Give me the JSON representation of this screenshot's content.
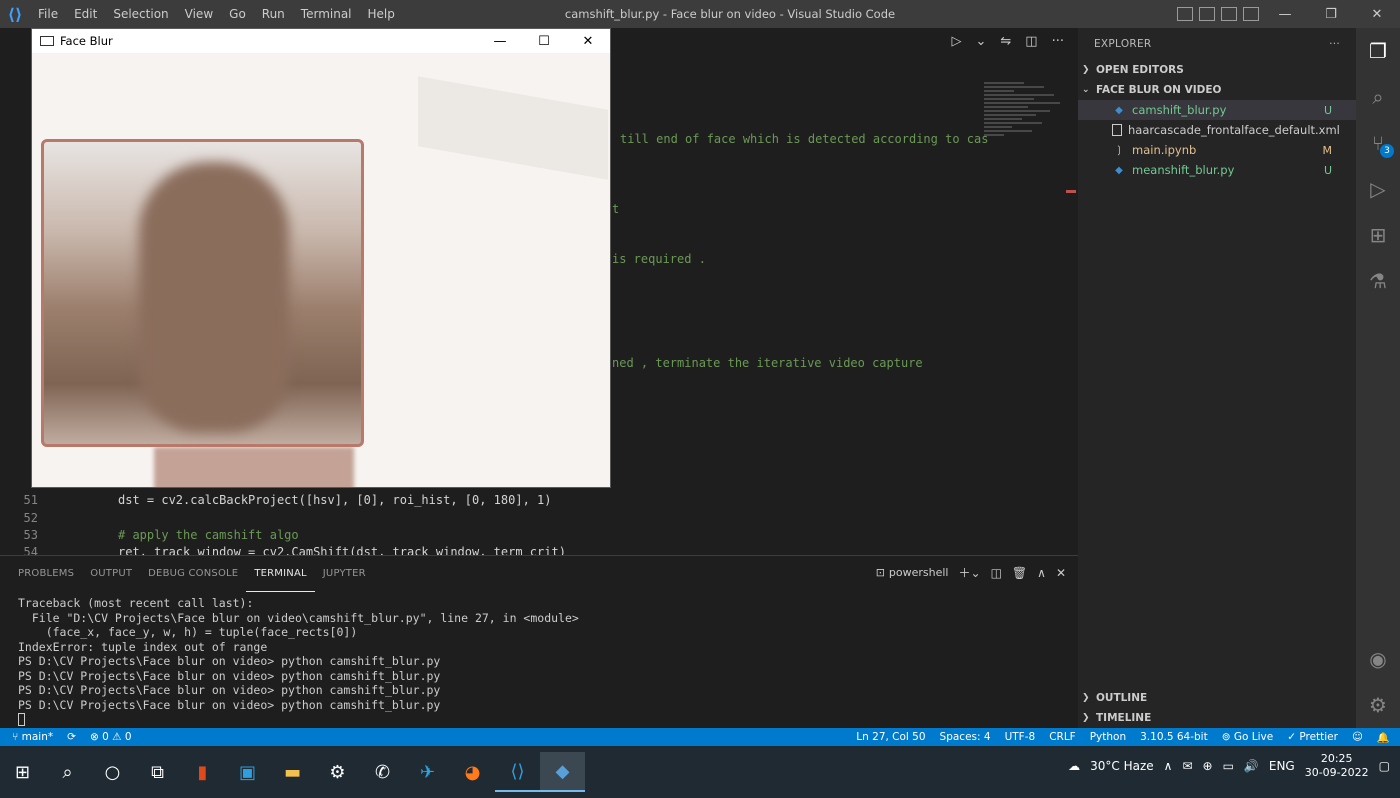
{
  "titlebar": {
    "menu": [
      "File",
      "Edit",
      "Selection",
      "View",
      "Go",
      "Run",
      "Terminal",
      "Help"
    ],
    "window_title": "camshift_blur.py - Face blur on video - Visual Studio Code"
  },
  "face_window": {
    "title": "Face Blur"
  },
  "editor": {
    "code_fragments": [
      "till end of face which is detected according to cas",
      "t",
      "is required .",
      "ned , terminate the iterative video capture"
    ],
    "lines": [
      {
        "num": "51",
        "code": "dst = cv2.calcBackProject([hsv], [0], roi_hist, [0, 180], 1)"
      },
      {
        "num": "52",
        "code": ""
      },
      {
        "num": "53",
        "code": "# apply the camshift algo"
      },
      {
        "num": "54",
        "code": "ret, track_window = cv2.CamShift(dst, track_window, term_crit)"
      }
    ]
  },
  "explorer": {
    "title": "EXPLORER",
    "open_editors": "OPEN EDITORS",
    "folder": "FACE BLUR ON VIDEO",
    "files": [
      {
        "name": "camshift_blur.py",
        "status": "U",
        "icon": "python-icon"
      },
      {
        "name": "haarcascade_frontalface_default.xml",
        "status": "",
        "icon": "xml-icon"
      },
      {
        "name": "main.ipynb",
        "status": "M",
        "icon": "notebook-icon"
      },
      {
        "name": "meanshift_blur.py",
        "status": "U",
        "icon": "python-icon"
      }
    ],
    "outline": "OUTLINE",
    "timeline": "TIMELINE"
  },
  "activity_bar": {
    "source_control_badge": "3"
  },
  "panel": {
    "tabs": [
      "PROBLEMS",
      "OUTPUT",
      "DEBUG CONSOLE",
      "TERMINAL",
      "JUPYTER"
    ],
    "active_tab": "TERMINAL",
    "shell": "powershell",
    "terminal_lines": [
      "Traceback (most recent call last):",
      "  File \"D:\\CV Projects\\Face blur on video\\camshift_blur.py\", line 27, in <module>",
      "    (face_x, face_y, w, h) = tuple(face_rects[0])",
      "IndexError: tuple index out of range",
      "PS D:\\CV Projects\\Face blur on video> python camshift_blur.py",
      "PS D:\\CV Projects\\Face blur on video> python camshift_blur.py",
      "PS D:\\CV Projects\\Face blur on video> python camshift_blur.py",
      "PS D:\\CV Projects\\Face blur on video> python camshift_blur.py"
    ]
  },
  "statusbar": {
    "branch": "main*",
    "problems": "⊗ 0 ⚠ 0",
    "position": "Ln 27, Col 50",
    "spaces": "Spaces: 4",
    "encoding": "UTF-8",
    "eol": "CRLF",
    "language": "Python",
    "interpreter": "3.10.5 64-bit",
    "golive": "Go Live",
    "prettier": "✓ Prettier"
  },
  "taskbar": {
    "weather": "30°C  Haze",
    "lang": "ENG",
    "time": "20:25",
    "date": "30-09-2022"
  },
  "colors": {
    "accent": "#007acc",
    "editor_bg": "#1e1e1e",
    "sidebar_bg": "#252526",
    "blur_border": "#b8796b"
  }
}
